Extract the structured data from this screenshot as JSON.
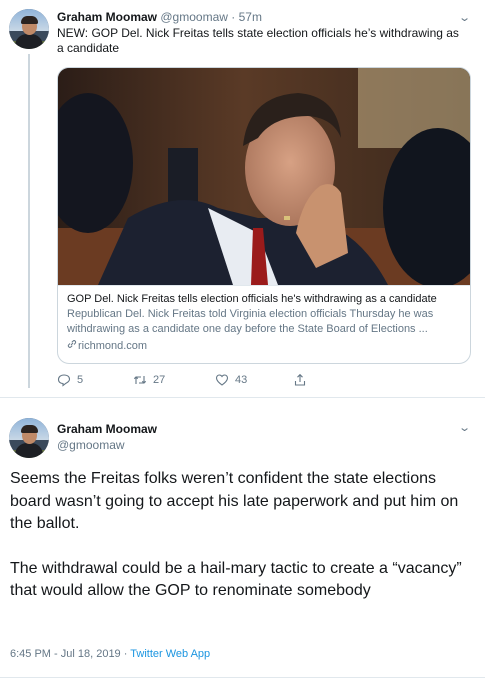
{
  "tweet1": {
    "author_name": "Graham Moomaw",
    "author_handle": "@gmoomaw",
    "separator": "·",
    "time": "57m",
    "text": "NEW: GOP Del. Nick Freitas tells state election officials he’s withdrawing as a candidate",
    "card": {
      "title": "GOP Del. Nick Freitas tells election officials he's withdrawing as a candidate",
      "description": "Republican Del. Nick Freitas told Virginia election officials Thursday he was withdrawing as a candidate one day before the State Board of Elections ...",
      "domain": "richmond.com"
    },
    "actions": {
      "reply_count": "5",
      "retweet_count": "27",
      "like_count": "43"
    }
  },
  "tweet2": {
    "author_name": "Graham Moomaw",
    "author_handle": "@gmoomaw",
    "paragraph1": "Seems the Freitas folks weren’t confident the state elections board wasn’t going to accept his late paperwork and put him on the ballot.",
    "paragraph2": "The withdrawal could be a hail-mary tactic to create a “vacancy” that would allow the GOP to renominate somebody",
    "timestamp": "6:45 PM - Jul 18, 2019",
    "separator": "·",
    "source": "Twitter Web App"
  },
  "icons": {
    "chevron": "chevron-down-icon",
    "reply": "reply-icon",
    "retweet": "retweet-icon",
    "like": "heart-icon",
    "share": "share-icon",
    "link": "link-icon"
  },
  "colors": {
    "text": "#14171a",
    "secondary": "#657786",
    "border": "#ccd6dd",
    "link": "#1b95e0"
  }
}
